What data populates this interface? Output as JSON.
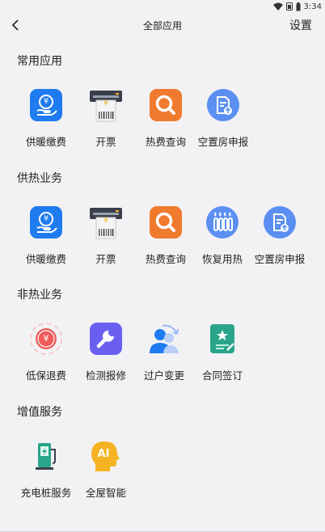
{
  "status_bar": {
    "time": "3:34"
  },
  "header": {
    "title": "全部应用",
    "settings_label": "设置"
  },
  "sections": [
    {
      "title": "常用应用",
      "apps": [
        {
          "label": "供暖缴费",
          "icon": "heating-payment-icon"
        },
        {
          "label": "开票",
          "icon": "invoice-printer-icon"
        },
        {
          "label": "热费查询",
          "icon": "search-icon"
        },
        {
          "label": "空置房申报",
          "icon": "vacant-report-icon"
        }
      ]
    },
    {
      "title": "供热业务",
      "apps": [
        {
          "label": "供暖缴费",
          "icon": "heating-payment-icon"
        },
        {
          "label": "开票",
          "icon": "invoice-printer-icon"
        },
        {
          "label": "热费查询",
          "icon": "search-icon"
        },
        {
          "label": "恢复用热",
          "icon": "radiator-icon"
        },
        {
          "label": "空置房申报",
          "icon": "vacant-report-icon"
        }
      ]
    },
    {
      "title": "非热业务",
      "apps": [
        {
          "label": "低保退费",
          "icon": "refund-icon"
        },
        {
          "label": "检测报修",
          "icon": "wrench-icon"
        },
        {
          "label": "过户变更",
          "icon": "transfer-user-icon"
        },
        {
          "label": "合同签订",
          "icon": "contract-icon"
        }
      ]
    },
    {
      "title": "增值服务",
      "apps": [
        {
          "label": "充电桩服务",
          "icon": "charging-pile-icon"
        },
        {
          "label": "全屋智能",
          "icon": "ai-head-icon"
        }
      ]
    }
  ],
  "icon_glyphs": {
    "yuan": "¥",
    "ai": "AI"
  },
  "colors": {
    "blue": "#1f7bf0",
    "orange": "#f07a2e",
    "light_blue": "#5b8ff2",
    "purple": "#6a5ff0",
    "teal": "#2aa58a",
    "yellow": "#f5b323",
    "red": "#f05a5a"
  }
}
